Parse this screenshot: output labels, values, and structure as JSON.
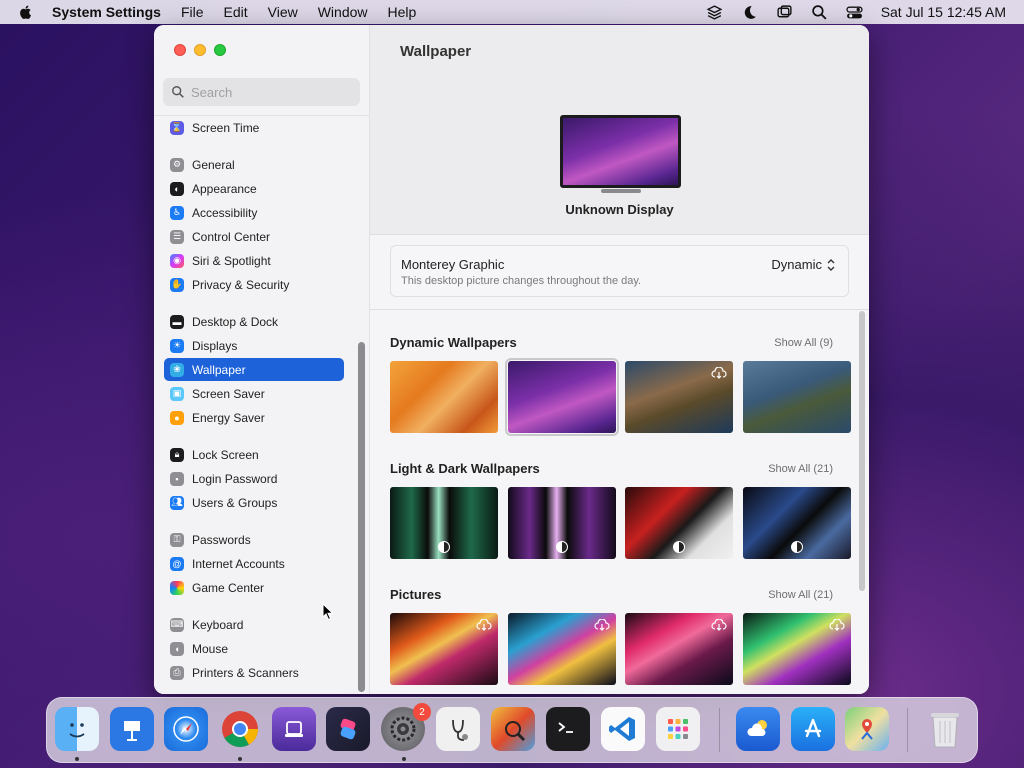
{
  "menubar": {
    "app_name": "System Settings",
    "menus": [
      "File",
      "Edit",
      "View",
      "Window",
      "Help"
    ],
    "clock": "Sat Jul 15  12:45 AM"
  },
  "sidebar": {
    "search_placeholder": "Search",
    "items": [
      {
        "label": "Screen Time",
        "icon": "hourglass-icon",
        "color": "#5e5ce6"
      },
      {
        "label": "General",
        "icon": "gear-icon",
        "color": "#8e8e93"
      },
      {
        "label": "Appearance",
        "icon": "appearance-icon",
        "color": "#1c1c1e"
      },
      {
        "label": "Accessibility",
        "icon": "accessibility-icon",
        "color": "#1b7bf5"
      },
      {
        "label": "Control Center",
        "icon": "control-center-icon",
        "color": "#8e8e93"
      },
      {
        "label": "Siri & Spotlight",
        "icon": "siri-icon",
        "color": "#b03ad6"
      },
      {
        "label": "Privacy & Security",
        "icon": "hand-icon",
        "color": "#1b7bf5"
      },
      {
        "label": "Desktop & Dock",
        "icon": "dock-icon",
        "color": "#1c1c1e"
      },
      {
        "label": "Displays",
        "icon": "sun-icon",
        "color": "#1b7bf5"
      },
      {
        "label": "Wallpaper",
        "icon": "wallpaper-icon",
        "color": "#32ade6"
      },
      {
        "label": "Screen Saver",
        "icon": "screen-saver-icon",
        "color": "#5ac8fa"
      },
      {
        "label": "Energy Saver",
        "icon": "bulb-icon",
        "color": "#ff9f0a"
      },
      {
        "label": "Lock Screen",
        "icon": "lock-icon",
        "color": "#1c1c1e"
      },
      {
        "label": "Login Password",
        "icon": "key-lock-icon",
        "color": "#8e8e93"
      },
      {
        "label": "Users & Groups",
        "icon": "users-icon",
        "color": "#1b7bf5"
      },
      {
        "label": "Passwords",
        "icon": "key-icon",
        "color": "#8e8e93"
      },
      {
        "label": "Internet Accounts",
        "icon": "at-icon",
        "color": "#1b7bf5"
      },
      {
        "label": "Game Center",
        "icon": "game-center-icon",
        "color": "#ff375f"
      },
      {
        "label": "Keyboard",
        "icon": "keyboard-icon",
        "color": "#8e8e93"
      },
      {
        "label": "Mouse",
        "icon": "mouse-icon",
        "color": "#8e8e93"
      },
      {
        "label": "Printers & Scanners",
        "icon": "printer-icon",
        "color": "#8e8e93"
      }
    ],
    "selected": "Wallpaper"
  },
  "main": {
    "title": "Wallpaper",
    "display_name": "Unknown Display",
    "current_wallpaper": {
      "name": "Monterey Graphic",
      "description": "This desktop picture changes throughout the day.",
      "mode": "Dynamic"
    },
    "sections": [
      {
        "title": "Dynamic Wallpapers",
        "show_all": "Show All (9)"
      },
      {
        "title": "Light & Dark Wallpapers",
        "show_all": "Show All (21)"
      },
      {
        "title": "Pictures",
        "show_all": "Show All (21)"
      }
    ]
  },
  "dock": {
    "apps": [
      "Finder",
      "Keynote",
      "Safari",
      "Chrome",
      "Apple Configurator",
      "Shortcuts",
      "System Settings",
      "System Information",
      "Instruments",
      "Terminal",
      "Visual Studio Code",
      "Launchpad",
      "Weather",
      "App Store",
      "Maps",
      "Trash"
    ],
    "settings_badge": "2"
  }
}
